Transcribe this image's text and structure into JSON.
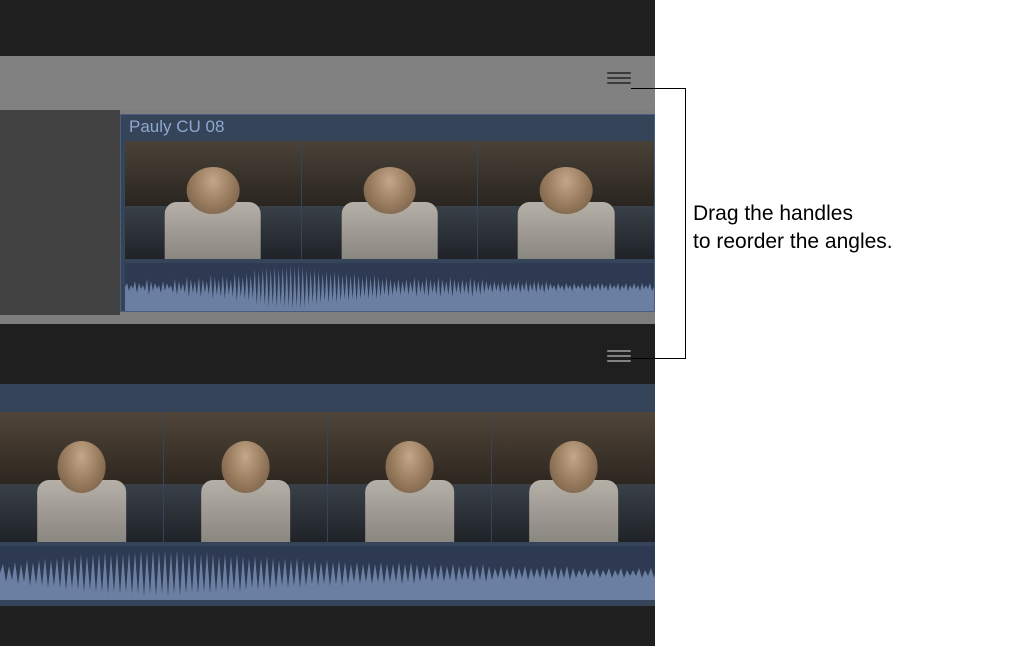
{
  "callout": {
    "line1": "Drag the handles",
    "line2": "to reorder the angles."
  },
  "angles": [
    {
      "clipLabel": "Pauly CU 08",
      "handleName": "reorder-handle-angle-1"
    },
    {
      "clipLabel": "",
      "handleName": "reorder-handle-angle-2"
    }
  ],
  "colors": {
    "clipBackground": "#36445a",
    "clipLabelColor": "#8fa8d0",
    "rowHeaderLight": "#818181",
    "rowHeaderDark": "#1f1f1f",
    "waveformFill": "#6b7fa3"
  }
}
